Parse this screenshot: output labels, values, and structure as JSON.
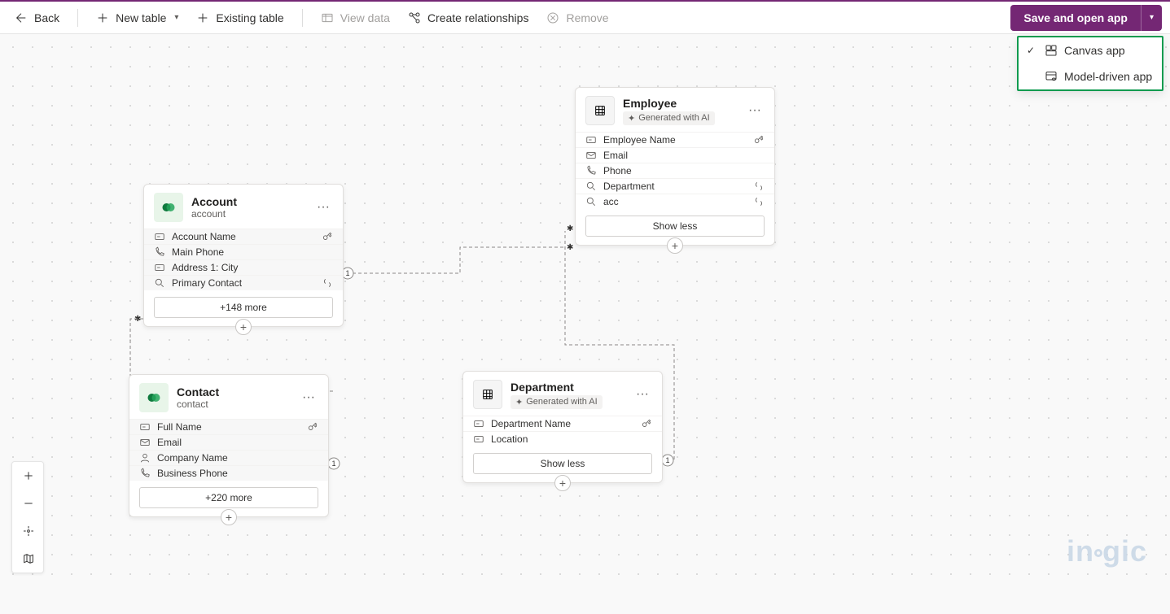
{
  "toolbar": {
    "back": "Back",
    "new_table": "New table",
    "existing_table": "Existing table",
    "view_data": "View data",
    "create_relationships": "Create relationships",
    "remove": "Remove",
    "save_btn": "Save and open app"
  },
  "dropdown": {
    "canvas": "Canvas app",
    "model_driven": "Model-driven app"
  },
  "cards": {
    "account": {
      "title": "Account",
      "subtitle": "account",
      "rows": [
        {
          "label": "Account Name",
          "icon": "text",
          "end": "key"
        },
        {
          "label": "Main Phone",
          "icon": "phone"
        },
        {
          "label": "Address 1: City",
          "icon": "text"
        },
        {
          "label": "Primary Contact",
          "icon": "lookup",
          "end": "lookup"
        }
      ],
      "more": "+148 more"
    },
    "contact": {
      "title": "Contact",
      "subtitle": "contact",
      "rows": [
        {
          "label": "Full Name",
          "icon": "text",
          "end": "key"
        },
        {
          "label": "Email",
          "icon": "mail"
        },
        {
          "label": "Company Name",
          "icon": "person"
        },
        {
          "label": "Business Phone",
          "icon": "phone"
        }
      ],
      "more": "+220 more"
    },
    "employee": {
      "title": "Employee",
      "ai_badge": "Generated with AI",
      "rows": [
        {
          "label": "Employee Name",
          "icon": "text",
          "end": "key"
        },
        {
          "label": "Email",
          "icon": "mail"
        },
        {
          "label": "Phone",
          "icon": "phone"
        },
        {
          "label": "Department",
          "icon": "lookup",
          "end": "lookup"
        },
        {
          "label": "acc",
          "icon": "lookup",
          "end": "lookup"
        }
      ],
      "less": "Show less"
    },
    "department": {
      "title": "Department",
      "ai_badge": "Generated with AI",
      "rows": [
        {
          "label": "Department Name",
          "icon": "text",
          "end": "key"
        },
        {
          "label": "Location",
          "icon": "text"
        }
      ],
      "less": "Show less"
    }
  },
  "watermark": "inogic"
}
